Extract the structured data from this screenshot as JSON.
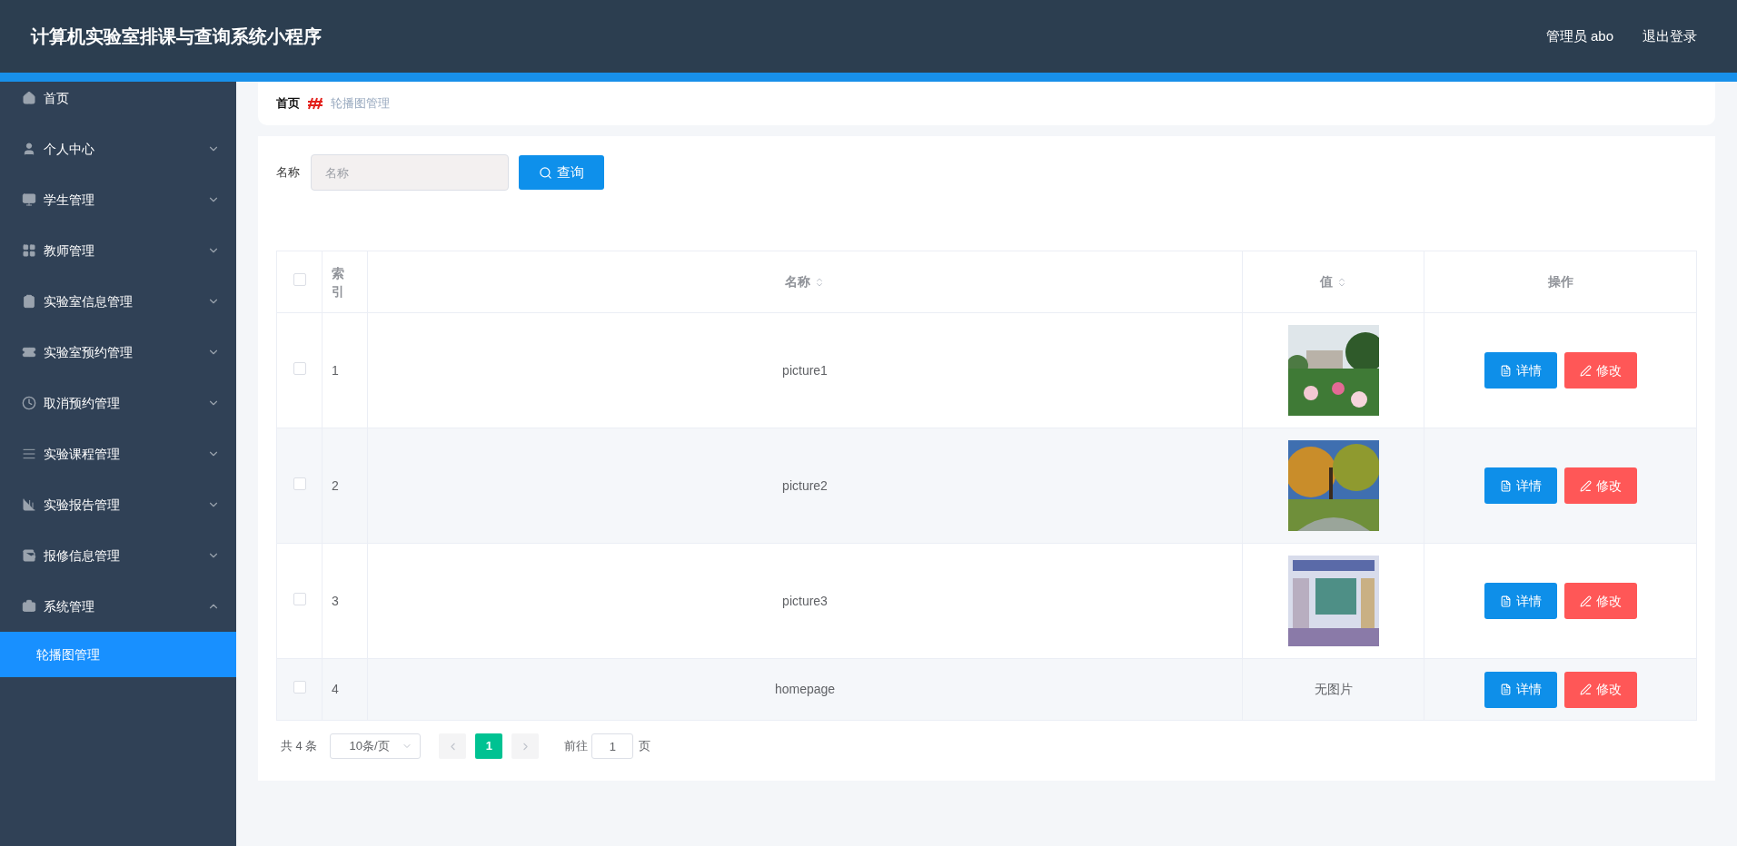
{
  "header": {
    "title": "计算机实验室排课与查询系统小程序",
    "user": "管理员 abo",
    "logout": "退出登录"
  },
  "sidebar": {
    "items": [
      {
        "label": "首页"
      },
      {
        "label": "个人中心",
        "expanded": false
      },
      {
        "label": "学生管理",
        "expanded": false
      },
      {
        "label": "教师管理",
        "expanded": false
      },
      {
        "label": "实验室信息管理",
        "expanded": false
      },
      {
        "label": "实验室预约管理",
        "expanded": false
      },
      {
        "label": "取消预约管理",
        "expanded": false
      },
      {
        "label": "实验课程管理",
        "expanded": false
      },
      {
        "label": "实验报告管理",
        "expanded": false
      },
      {
        "label": "报修信息管理",
        "expanded": false
      },
      {
        "label": "系统管理",
        "expanded": true,
        "children": [
          {
            "label": "轮播图管理",
            "selected": true
          }
        ]
      }
    ]
  },
  "breadcrumb": [
    "首页",
    "轮播图管理"
  ],
  "search": {
    "label": "名称",
    "placeholder": "名称",
    "button": "查询"
  },
  "table": {
    "select_all_checked": false,
    "columns": [
      "索引",
      "名称",
      "值",
      "操作"
    ],
    "rows": [
      {
        "checked": false,
        "index": "1",
        "name": "picture1",
        "actions": [
          "详情",
          "修改"
        ]
      },
      {
        "checked": false,
        "index": "2",
        "name": "picture2",
        "actions": [
          "详情",
          "修改"
        ]
      },
      {
        "checked": false,
        "index": "3",
        "name": "picture3",
        "actions": [
          "详情",
          "修改"
        ]
      },
      {
        "checked": false,
        "index": "4",
        "name": "homepage",
        "value": {
          "kind": "text",
          "text": "无图片"
        },
        "actions": [
          "详情",
          "修改"
        ]
      }
    ]
  },
  "pagination": {
    "total": "共 4 条",
    "page_size": "10条/页",
    "pages": [
      {
        "label": "1",
        "selected": true
      }
    ],
    "goto_label": "前往",
    "goto_value": "1",
    "goto_suffix": "页"
  }
}
